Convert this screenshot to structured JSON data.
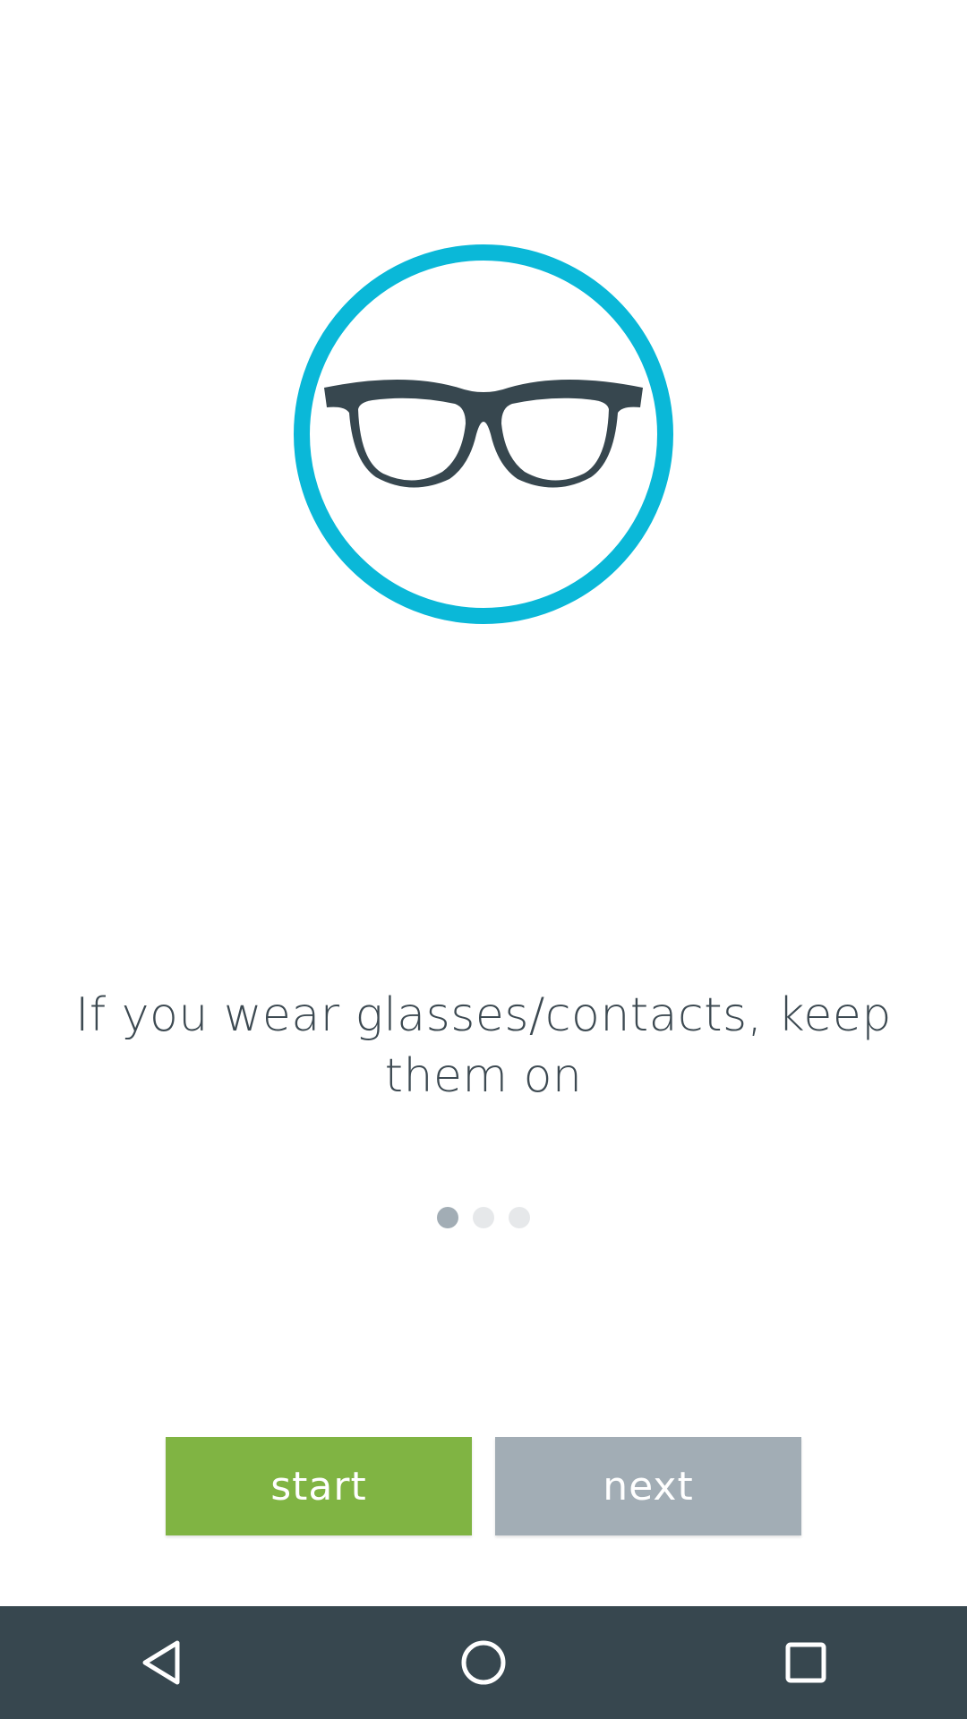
{
  "colors": {
    "accent_ring": "#0ab8d8",
    "glasses": "#37474f",
    "start_button": "#80b443",
    "next_button": "#a2adb5",
    "text": "#3d4a52",
    "nav_bar": "#37474f",
    "dot_active": "#a2adb5",
    "dot_inactive": "#e6e8ea"
  },
  "illustration": {
    "icon": "glasses-icon"
  },
  "message": {
    "text": "If you wear glasses/contacts, keep them on"
  },
  "pager": {
    "total": 3,
    "current": 1
  },
  "buttons": {
    "start_label": "start",
    "next_label": "next"
  },
  "navbar": {
    "back_icon": "back-triangle-icon",
    "home_icon": "home-circle-icon",
    "recents_icon": "recents-square-icon"
  }
}
